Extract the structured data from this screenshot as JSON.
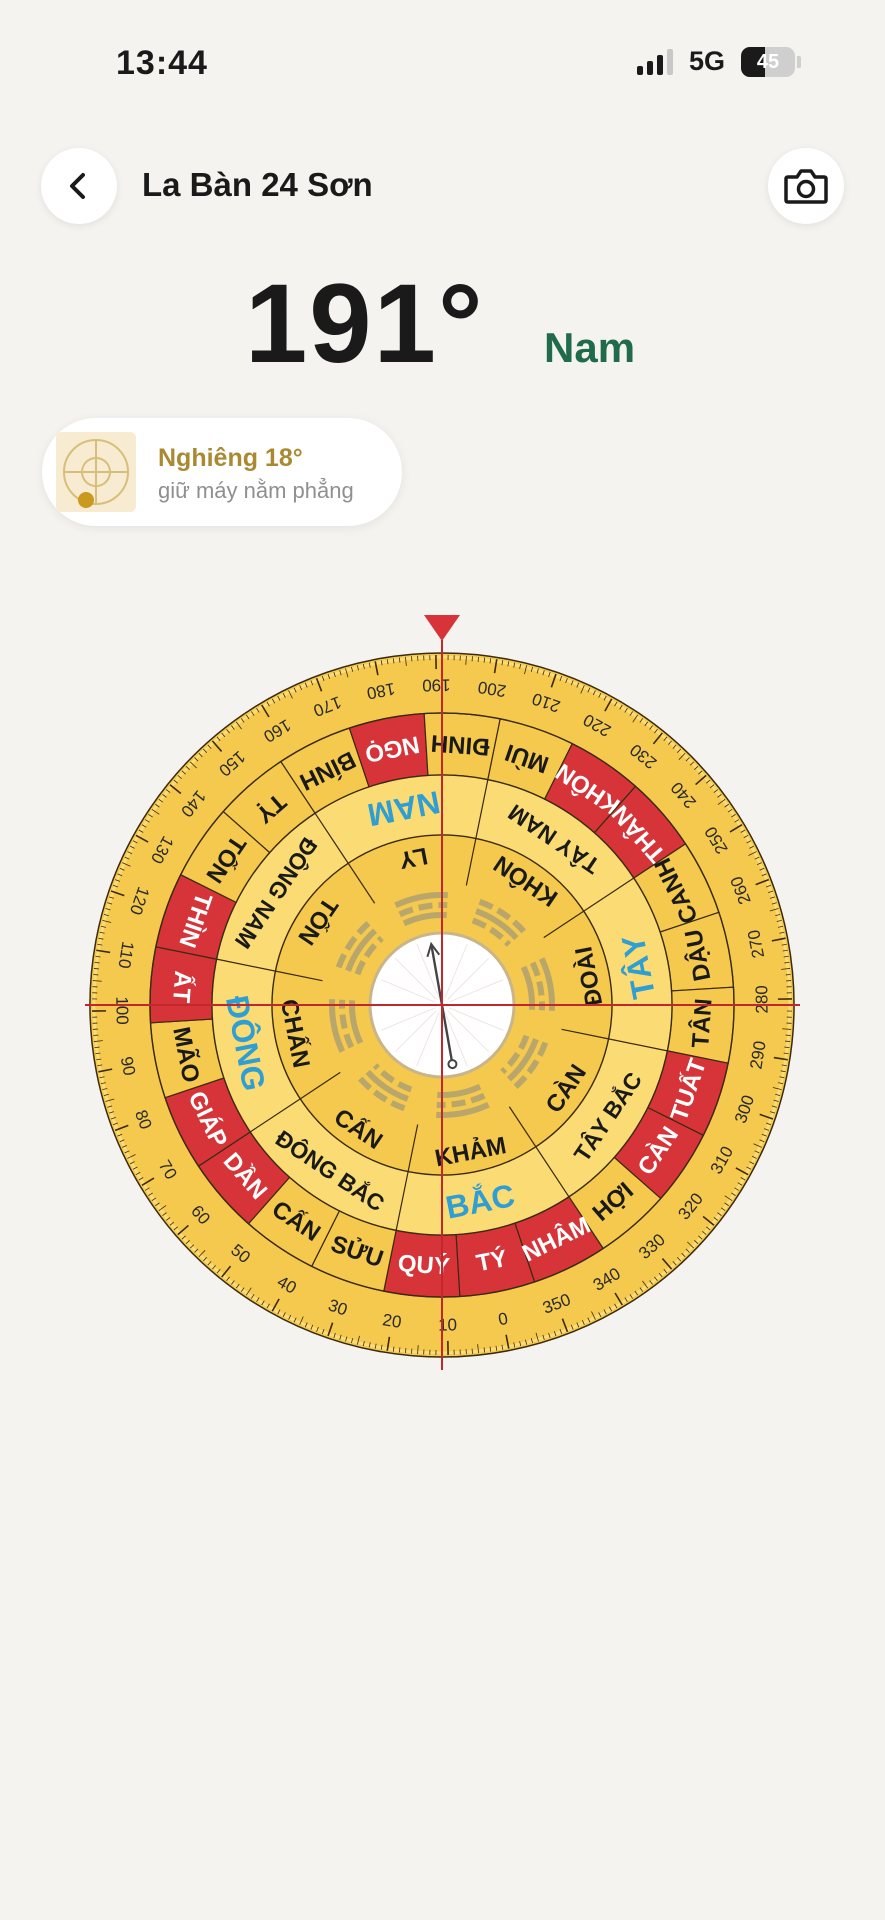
{
  "status_bar": {
    "time": "13:44",
    "network": "5G",
    "battery": "45",
    "battery_level": 0.45
  },
  "header": {
    "title": "La Bàn 24 Sơn",
    "back_icon": "chevron-left-icon",
    "camera_icon": "camera-icon"
  },
  "heading": {
    "degrees": "191°",
    "direction": "Nam",
    "direction_color": "#1f6b4a"
  },
  "tilt": {
    "title": "Nghiêng 18°",
    "hint": "giữ máy nằm phẳng",
    "icon": "level-icon"
  },
  "compass": {
    "rotation_deg": 191,
    "needle_deg": 191,
    "colors": {
      "face": "#f4c94e",
      "face_light": "#fbdc74",
      "red": "#d7343a",
      "line": "#3a2a10",
      "blue": "#2f9ed3",
      "crosshair": "#c1272d"
    },
    "mountains": [
      {
        "name": "TÝ",
        "hl": true
      },
      {
        "name": "QUÝ",
        "hl": true
      },
      {
        "name": "SỬU",
        "hl": false
      },
      {
        "name": "CẤN",
        "hl": false
      },
      {
        "name": "DẦN",
        "hl": true
      },
      {
        "name": "GIÁP",
        "hl": true
      },
      {
        "name": "MÃO",
        "hl": false
      },
      {
        "name": "ẤT",
        "hl": true
      },
      {
        "name": "THÌN",
        "hl": true
      },
      {
        "name": "TỐN",
        "hl": false
      },
      {
        "name": "TỴ",
        "hl": false
      },
      {
        "name": "BÍNH",
        "hl": false
      },
      {
        "name": "NGỌ",
        "hl": true
      },
      {
        "name": "ĐINH",
        "hl": false
      },
      {
        "name": "MÙI",
        "hl": false
      },
      {
        "name": "KHÔN",
        "hl": true
      },
      {
        "name": "THÂN",
        "hl": true
      },
      {
        "name": "CANH",
        "hl": false
      },
      {
        "name": "DẬU",
        "hl": false
      },
      {
        "name": "TÂN",
        "hl": false
      },
      {
        "name": "TUẤT",
        "hl": true
      },
      {
        "name": "CÀN",
        "hl": true
      },
      {
        "name": "HỢI",
        "hl": false
      },
      {
        "name": "NHÂM",
        "hl": true
      }
    ],
    "mountains_start_deg": 352.5,
    "directions": [
      {
        "name": "BẮC",
        "deg": 0,
        "main": true
      },
      {
        "name": "ĐÔNG BẮC",
        "deg": 45,
        "main": false
      },
      {
        "name": "ĐÔNG",
        "deg": 90,
        "main": true
      },
      {
        "name": "ĐÔNG NAM",
        "deg": 135,
        "main": false
      },
      {
        "name": "NAM",
        "deg": 180,
        "main": true
      },
      {
        "name": "TÂY NAM",
        "deg": 225,
        "main": false
      },
      {
        "name": "TÂY",
        "deg": 270,
        "main": true
      },
      {
        "name": "TÂY BẮC",
        "deg": 315,
        "main": false
      }
    ],
    "trigrams": [
      {
        "name": "KHẢM",
        "deg": 0
      },
      {
        "name": "CẤN",
        "deg": 45
      },
      {
        "name": "CHẤN",
        "deg": 90
      },
      {
        "name": "TỐN",
        "deg": 135
      },
      {
        "name": "LY",
        "deg": 180
      },
      {
        "name": "KHÔN",
        "deg": 225
      },
      {
        "name": "ĐOÀI",
        "deg": 270
      },
      {
        "name": "CÀN",
        "deg": 315
      }
    ],
    "degree_labels": [
      "0",
      "10",
      "20",
      "30",
      "40",
      "50",
      "60",
      "70",
      "80",
      "90",
      "100",
      "110",
      "120",
      "130",
      "140",
      "150",
      "160",
      "170",
      "180",
      "190",
      "200",
      "210",
      "220",
      "230",
      "240",
      "250",
      "260",
      "270",
      "280",
      "290",
      "300",
      "310",
      "320",
      "330",
      "340",
      "350"
    ]
  }
}
